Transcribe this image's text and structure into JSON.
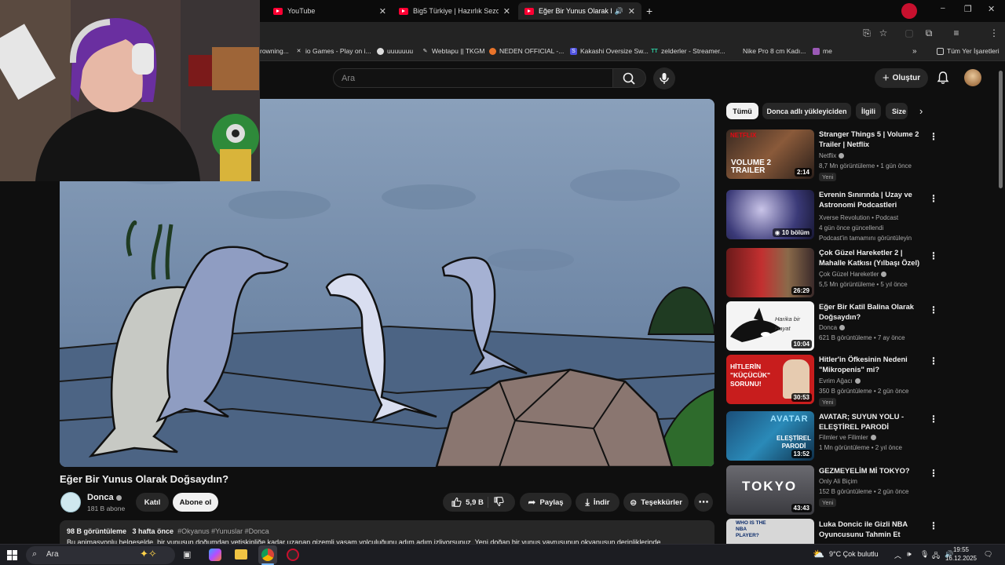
{
  "browser": {
    "tabs": [
      {
        "label": "YouTube",
        "active": false
      },
      {
        "label": "Big5 Türkiye | Hazırlık Sezonu -",
        "active": false
      },
      {
        "label": "Eğer Bir Yunus Olarak Doğ",
        "active": true
      }
    ],
    "new_tab": "+",
    "bookmarks": [
      "rowning...",
      "io Games - Play on i...",
      "uuuuuuu",
      "Webtapu || TKGM",
      "NEDEN OFFICIAL -...",
      "Kakashi Oversize Sw...",
      "zelderler - Streamer...",
      "Nike Pro 8 cm Kadı...",
      "me"
    ],
    "all_bookmarks": "Tüm Yer İşaretleri",
    "profile_letter": "Z"
  },
  "youtube": {
    "search_placeholder": "Ara",
    "create_label": "Oluştur",
    "video": {
      "title": "Eğer Bir Yunus Olarak Doğsaydın?",
      "channel": "Donca",
      "subscribers": "181 B abone",
      "join_label": "Katıl",
      "subscribe_label": "Abone ol",
      "likes": "5,9 B",
      "share_label": "Paylaş",
      "download_label": "İndir",
      "thanks_label": "Teşekkürler",
      "views": "98 B görüntüleme",
      "age": "3 hafta önce",
      "tags": "#Okyanus #Yunuslar #Donca",
      "description": "Bu animasyonlu belgeselde, bir yunusun doğumdan yetişkinliğe kadar uzanan gizemli yaşam yolculuğunu adım adım izliyorsunuz. Yeni doğan bir yunus yavrusunun okyanusun derinliklerinde"
    },
    "chips": [
      "Tümü",
      "Donca adlı yükleyiciden",
      "İlgili",
      "Size"
    ],
    "recommendations": [
      {
        "title": "Stranger Things 5 | Volume 2 Trailer | Netflix",
        "channel": "Netflix",
        "meta": "8,7 Mn görüntüleme • 1 gün önce",
        "duration": "2:14",
        "badge": "Yeni",
        "thumb_text": "VOLUME 2 TRAILER",
        "thumb_brand": "NETFLIX"
      },
      {
        "title": "Evrenin Sınırında | Uzay ve Astronomi Podcastleri",
        "channel": "Xverse Revolution • Podcast",
        "meta": "4 gün önce güncellendi",
        "extra": "Podcast'in tamamını görüntüleyin",
        "duration": "10 bölüm"
      },
      {
        "title": "Çok Güzel Hareketler 2 | Mahalle Katkısı (Yılbaşı Özel)",
        "channel": "Çok Güzel Hareketler",
        "meta": "5,5 Mn görüntüleme • 5 yıl önce",
        "duration": "26:29"
      },
      {
        "title": "Eğer Bir Katil Balina Olarak Doğsaydın?",
        "channel": "Donca",
        "meta": "621 B görüntüleme • 7 ay önce",
        "duration": "10:04",
        "thumb_text": "Harika bir Hayat"
      },
      {
        "title": "Hitler'in Öfkesinin Nedeni \"Mikropenis\" mi?",
        "channel": "Evrim Ağacı",
        "meta": "350 B görüntüleme • 2 gün önce",
        "duration": "30:53",
        "badge": "Yeni",
        "thumb_text": "HİTLERİN \"KÜÇÜCÜK\" SORUNU!"
      },
      {
        "title": "AVATAR; SUYUN YOLU - ELEŞTİREL PARODİ",
        "channel": "Filmler ve Filimler",
        "meta": "1 Mn görüntüleme • 2 yıl önce",
        "duration": "13:52",
        "thumb_text": "ELEŞTİREL PARODİ",
        "thumb_brand": "AVATAR"
      },
      {
        "title": "GEZMEYELİM Mİ TOKYO?",
        "channel": "Only Ali Biçim",
        "meta": "152 B görüntüleme • 2 gün önce",
        "duration": "43:43",
        "badge": "Yeni",
        "thumb_text": "TOKYO"
      },
      {
        "title": "Luka Doncic ile Gizli NBA Oyuncusunu Tahmin Et",
        "channel": "",
        "meta": "",
        "thumb_text": "WHO IS THE NBA PLAYER?"
      }
    ]
  },
  "taskbar": {
    "search_label": "Ara",
    "weather": "9°C  Çok bulutlu",
    "time": "19:55",
    "date": "16.12.2025"
  },
  "colors": {
    "yt_red": "#ff0033",
    "bg": "#0f0f0f",
    "surface": "#272727"
  }
}
